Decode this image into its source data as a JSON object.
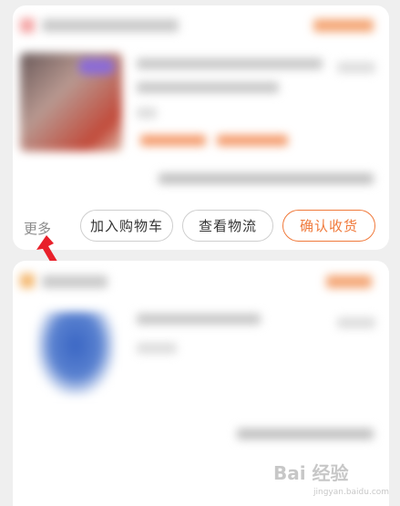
{
  "order1": {
    "actions": {
      "more_label": "更多",
      "add_to_cart_label": "加入购物车",
      "view_logistics_label": "查看物流",
      "confirm_receipt_label": "确认收货"
    }
  },
  "colors": {
    "accent": "#f07a3c",
    "background": "#efefef",
    "card": "#ffffff",
    "annotation_arrow": "#e8202a"
  },
  "watermark": {
    "logo": "Bai 经验",
    "sub": "jingyan.baidu.com"
  }
}
